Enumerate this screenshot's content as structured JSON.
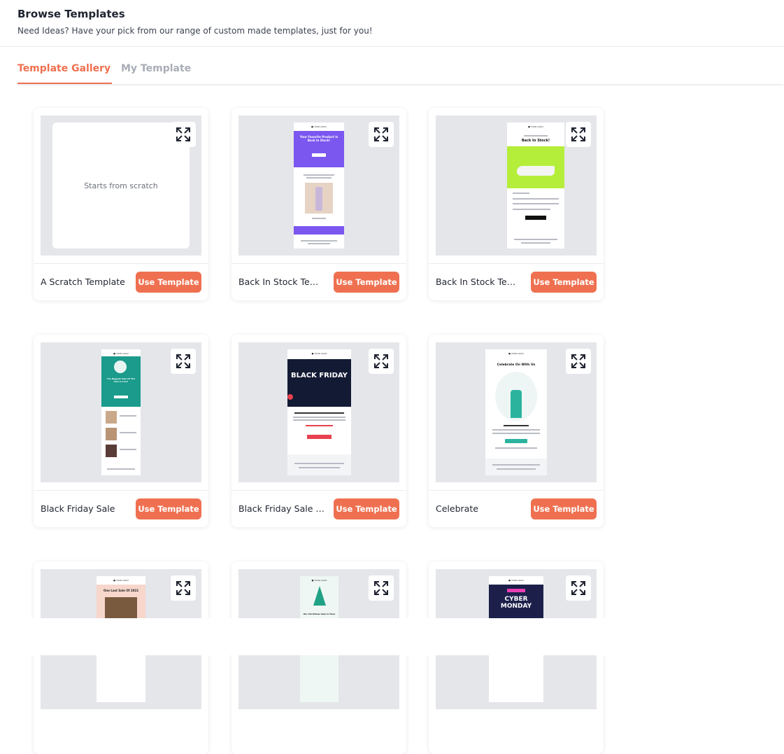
{
  "header": {
    "title": "Browse Templates",
    "subtitle": "Need Ideas? Have your pick from our range of custom made templates, just for you!"
  },
  "tabs": [
    {
      "label": "Template Gallery",
      "active": true
    },
    {
      "label": "My Template",
      "active": false
    }
  ],
  "colors": {
    "accent": "#ef7050",
    "thumb_bg": "#e4e6ea"
  },
  "use_button_label": "Use Template",
  "templates": [
    {
      "name": "A Scratch Template",
      "preview_text": "Starts from scratch"
    },
    {
      "name": "Back In Stock Templ...",
      "preview_heading": "Your Favorite Product Is Back In Stock!"
    },
    {
      "name": "Back In Stock Templ...",
      "preview_heading": "Back In Stock!"
    },
    {
      "name": "Black Friday Sale",
      "preview_heading": "The Biggest Sale Of The Year Is Live!"
    },
    {
      "name": "Black Friday Sale Te...",
      "preview_heading": "BLACK FRIDAY"
    },
    {
      "name": "Celebrate",
      "preview_heading": "Celebrate On With Us"
    },
    {
      "name": "",
      "preview_heading": "One Last Sale Of 2022"
    },
    {
      "name": "",
      "preview_heading": "Our Christmas Sale Is Here"
    },
    {
      "name": "",
      "preview_heading": "CYBER MONDAY"
    }
  ]
}
